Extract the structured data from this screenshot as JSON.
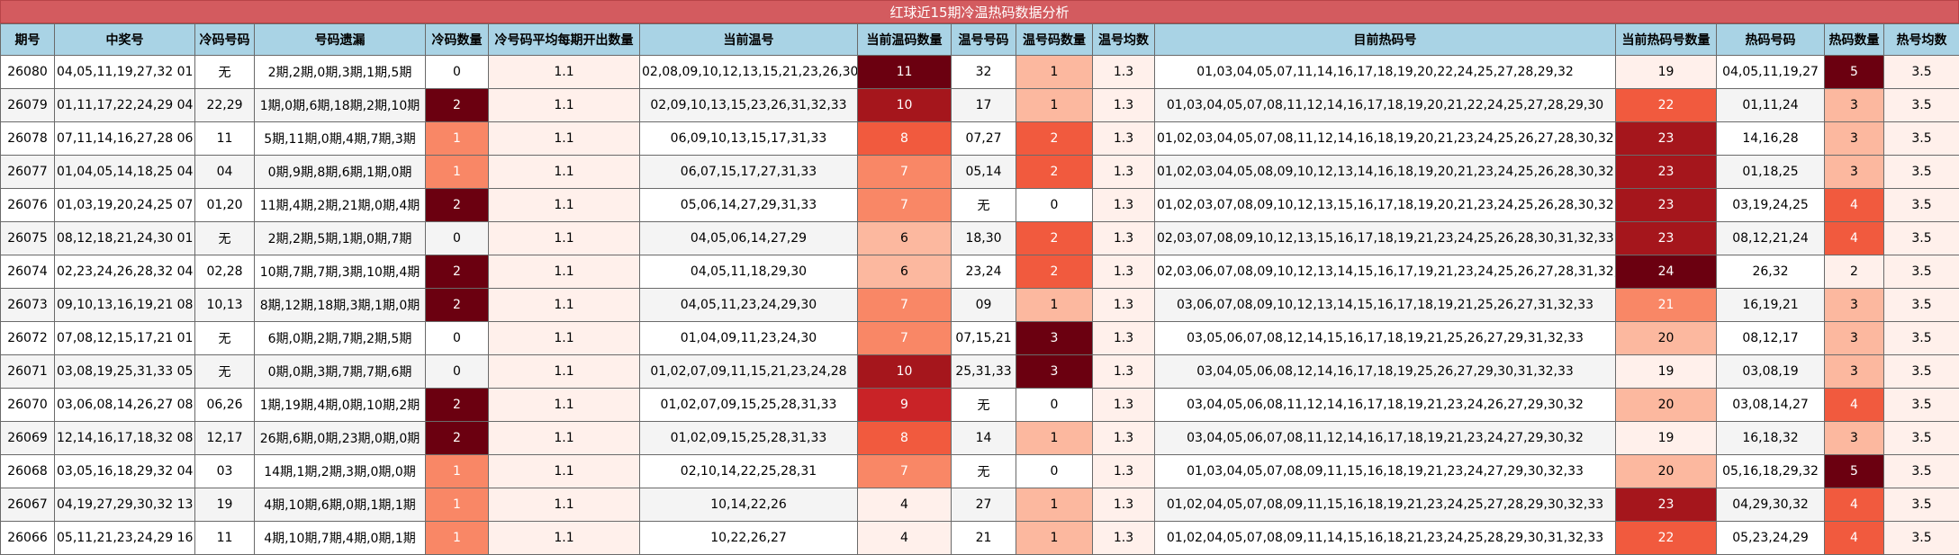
{
  "title": "红球近15期冷温热码数据分析",
  "columns": [
    "期号",
    "中奖号",
    "冷码号码",
    "号码遗漏",
    "冷码数量",
    "冷号码平均每期开出数量",
    "当前温号",
    "当前温码数量",
    "温号号码",
    "温号码数量",
    "温号均数",
    "目前热码号",
    "当前热码号数量",
    "热码号码",
    "热码数量",
    "热号均数"
  ],
  "rows": [
    {
      "period": "26080",
      "draw": "04,05,11,19,27,32 01",
      "cold_nums": "无",
      "miss": "2期,2期,0期,3期,1期,5期",
      "cold_count": "0",
      "cold_avg": "1.1",
      "warm_cur": "02,08,09,10,12,13,15,21,23,26,30",
      "warm_cur_count": "11",
      "warm_nums": "32",
      "warm_count": "1",
      "warm_avg": "1.3",
      "hot_cur": "01,03,04,05,07,11,14,16,17,18,19,20,22,24,25,27,28,29,32",
      "hot_cur_count": "19",
      "hot_nums": "04,05,11,19,27",
      "hot_count": "5",
      "hot_avg": "3.5"
    },
    {
      "period": "26079",
      "draw": "01,11,17,22,24,29 04",
      "cold_nums": "22,29",
      "miss": "1期,0期,6期,18期,2期,10期",
      "cold_count": "2",
      "cold_avg": "1.1",
      "warm_cur": "02,09,10,13,15,23,26,31,32,33",
      "warm_cur_count": "10",
      "warm_nums": "17",
      "warm_count": "1",
      "warm_avg": "1.3",
      "hot_cur": "01,03,04,05,07,08,11,12,14,16,17,18,19,20,21,22,24,25,27,28,29,30",
      "hot_cur_count": "22",
      "hot_nums": "01,11,24",
      "hot_count": "3",
      "hot_avg": "3.5"
    },
    {
      "period": "26078",
      "draw": "07,11,14,16,27,28 06",
      "cold_nums": "11",
      "miss": "5期,11期,0期,4期,7期,3期",
      "cold_count": "1",
      "cold_avg": "1.1",
      "warm_cur": "06,09,10,13,15,17,31,33",
      "warm_cur_count": "8",
      "warm_nums": "07,27",
      "warm_count": "2",
      "warm_avg": "1.3",
      "hot_cur": "01,02,03,04,05,07,08,11,12,14,16,18,19,20,21,23,24,25,26,27,28,30,32",
      "hot_cur_count": "23",
      "hot_nums": "14,16,28",
      "hot_count": "3",
      "hot_avg": "3.5"
    },
    {
      "period": "26077",
      "draw": "01,04,05,14,18,25 04",
      "cold_nums": "04",
      "miss": "0期,9期,8期,6期,1期,0期",
      "cold_count": "1",
      "cold_avg": "1.1",
      "warm_cur": "06,07,15,17,27,31,33",
      "warm_cur_count": "7",
      "warm_nums": "05,14",
      "warm_count": "2",
      "warm_avg": "1.3",
      "hot_cur": "01,02,03,04,05,08,09,10,12,13,14,16,18,19,20,21,23,24,25,26,28,30,32",
      "hot_cur_count": "23",
      "hot_nums": "01,18,25",
      "hot_count": "3",
      "hot_avg": "3.5"
    },
    {
      "period": "26076",
      "draw": "01,03,19,20,24,25 07",
      "cold_nums": "01,20",
      "miss": "11期,4期,2期,21期,0期,4期",
      "cold_count": "2",
      "cold_avg": "1.1",
      "warm_cur": "05,06,14,27,29,31,33",
      "warm_cur_count": "7",
      "warm_nums": "无",
      "warm_count": "0",
      "warm_avg": "1.3",
      "hot_cur": "01,02,03,07,08,09,10,12,13,15,16,17,18,19,20,21,23,24,25,26,28,30,32",
      "hot_cur_count": "23",
      "hot_nums": "03,19,24,25",
      "hot_count": "4",
      "hot_avg": "3.5"
    },
    {
      "period": "26075",
      "draw": "08,12,18,21,24,30 01",
      "cold_nums": "无",
      "miss": "2期,2期,5期,1期,0期,7期",
      "cold_count": "0",
      "cold_avg": "1.1",
      "warm_cur": "04,05,06,14,27,29",
      "warm_cur_count": "6",
      "warm_nums": "18,30",
      "warm_count": "2",
      "warm_avg": "1.3",
      "hot_cur": "02,03,07,08,09,10,12,13,15,16,17,18,19,21,23,24,25,26,28,30,31,32,33",
      "hot_cur_count": "23",
      "hot_nums": "08,12,21,24",
      "hot_count": "4",
      "hot_avg": "3.5"
    },
    {
      "period": "26074",
      "draw": "02,23,24,26,28,32 04",
      "cold_nums": "02,28",
      "miss": "10期,7期,7期,3期,10期,4期",
      "cold_count": "2",
      "cold_avg": "1.1",
      "warm_cur": "04,05,11,18,29,30",
      "warm_cur_count": "6",
      "warm_nums": "23,24",
      "warm_count": "2",
      "warm_avg": "1.3",
      "hot_cur": "02,03,06,07,08,09,10,12,13,14,15,16,17,19,21,23,24,25,26,27,28,31,32,33",
      "hot_cur_count": "24",
      "hot_nums": "26,32",
      "hot_count": "2",
      "hot_avg": "3.5"
    },
    {
      "period": "26073",
      "draw": "09,10,13,16,19,21 08",
      "cold_nums": "10,13",
      "miss": "8期,12期,18期,3期,1期,0期",
      "cold_count": "2",
      "cold_avg": "1.1",
      "warm_cur": "04,05,11,23,24,29,30",
      "warm_cur_count": "7",
      "warm_nums": "09",
      "warm_count": "1",
      "warm_avg": "1.3",
      "hot_cur": "03,06,07,08,09,10,12,13,14,15,16,17,18,19,21,25,26,27,31,32,33",
      "hot_cur_count": "21",
      "hot_nums": "16,19,21",
      "hot_count": "3",
      "hot_avg": "3.5"
    },
    {
      "period": "26072",
      "draw": "07,08,12,15,17,21 01",
      "cold_nums": "无",
      "miss": "6期,0期,2期,7期,2期,5期",
      "cold_count": "0",
      "cold_avg": "1.1",
      "warm_cur": "01,04,09,11,23,24,30",
      "warm_cur_count": "7",
      "warm_nums": "07,15,21",
      "warm_count": "3",
      "warm_avg": "1.3",
      "hot_cur": "03,05,06,07,08,12,14,15,16,17,18,19,21,25,26,27,29,31,32,33",
      "hot_cur_count": "20",
      "hot_nums": "08,12,17",
      "hot_count": "3",
      "hot_avg": "3.5"
    },
    {
      "period": "26071",
      "draw": "03,08,19,25,31,33 05",
      "cold_nums": "无",
      "miss": "0期,0期,3期,7期,7期,6期",
      "cold_count": "0",
      "cold_avg": "1.1",
      "warm_cur": "01,02,07,09,11,15,21,23,24,28",
      "warm_cur_count": "10",
      "warm_nums": "25,31,33",
      "warm_count": "3",
      "warm_avg": "1.3",
      "hot_cur": "03,04,05,06,08,12,14,16,17,18,19,25,26,27,29,30,31,32,33",
      "hot_cur_count": "19",
      "hot_nums": "03,08,19",
      "hot_count": "3",
      "hot_avg": "3.5"
    },
    {
      "period": "26070",
      "draw": "03,06,08,14,26,27 08",
      "cold_nums": "06,26",
      "miss": "1期,19期,4期,0期,10期,2期",
      "cold_count": "2",
      "cold_avg": "1.1",
      "warm_cur": "01,02,07,09,15,25,28,31,33",
      "warm_cur_count": "9",
      "warm_nums": "无",
      "warm_count": "0",
      "warm_avg": "1.3",
      "hot_cur": "03,04,05,06,08,11,12,14,16,17,18,19,21,23,24,26,27,29,30,32",
      "hot_cur_count": "20",
      "hot_nums": "03,08,14,27",
      "hot_count": "4",
      "hot_avg": "3.5"
    },
    {
      "period": "26069",
      "draw": "12,14,16,17,18,32 08",
      "cold_nums": "12,17",
      "miss": "26期,6期,0期,23期,0期,0期",
      "cold_count": "2",
      "cold_avg": "1.1",
      "warm_cur": "01,02,09,15,25,28,31,33",
      "warm_cur_count": "8",
      "warm_nums": "14",
      "warm_count": "1",
      "warm_avg": "1.3",
      "hot_cur": "03,04,05,06,07,08,11,12,14,16,17,18,19,21,23,24,27,29,30,32",
      "hot_cur_count": "19",
      "hot_nums": "16,18,32",
      "hot_count": "3",
      "hot_avg": "3.5"
    },
    {
      "period": "26068",
      "draw": "03,05,16,18,29,32 04",
      "cold_nums": "03",
      "miss": "14期,1期,2期,3期,0期,0期",
      "cold_count": "1",
      "cold_avg": "1.1",
      "warm_cur": "02,10,14,22,25,28,31",
      "warm_cur_count": "7",
      "warm_nums": "无",
      "warm_count": "0",
      "warm_avg": "1.3",
      "hot_cur": "01,03,04,05,07,08,09,11,15,16,18,19,21,23,24,27,29,30,32,33",
      "hot_cur_count": "20",
      "hot_nums": "05,16,18,29,32",
      "hot_count": "5",
      "hot_avg": "3.5"
    },
    {
      "period": "26067",
      "draw": "04,19,27,29,30,32 13",
      "cold_nums": "19",
      "miss": "4期,10期,6期,0期,1期,1期",
      "cold_count": "1",
      "cold_avg": "1.1",
      "warm_cur": "10,14,22,26",
      "warm_cur_count": "4",
      "warm_nums": "27",
      "warm_count": "1",
      "warm_avg": "1.3",
      "hot_cur": "01,02,04,05,07,08,09,11,15,16,18,19,21,23,24,25,27,28,29,30,32,33",
      "hot_cur_count": "23",
      "hot_nums": "04,29,30,32",
      "hot_count": "4",
      "hot_avg": "3.5"
    },
    {
      "period": "26066",
      "draw": "05,11,21,23,24,29 16",
      "cold_nums": "11",
      "miss": "4期,10期,7期,4期,0期,1期",
      "cold_count": "1",
      "cold_avg": "1.1",
      "warm_cur": "10,22,26,27",
      "warm_cur_count": "4",
      "warm_nums": "21",
      "warm_count": "1",
      "warm_avg": "1.3",
      "hot_cur": "01,02,04,05,07,08,09,11,14,15,16,18,21,23,24,25,28,29,30,31,32,33",
      "hot_cur_count": "22",
      "hot_nums": "05,23,24,29",
      "hot_count": "4",
      "hot_avg": "3.5"
    }
  ]
}
